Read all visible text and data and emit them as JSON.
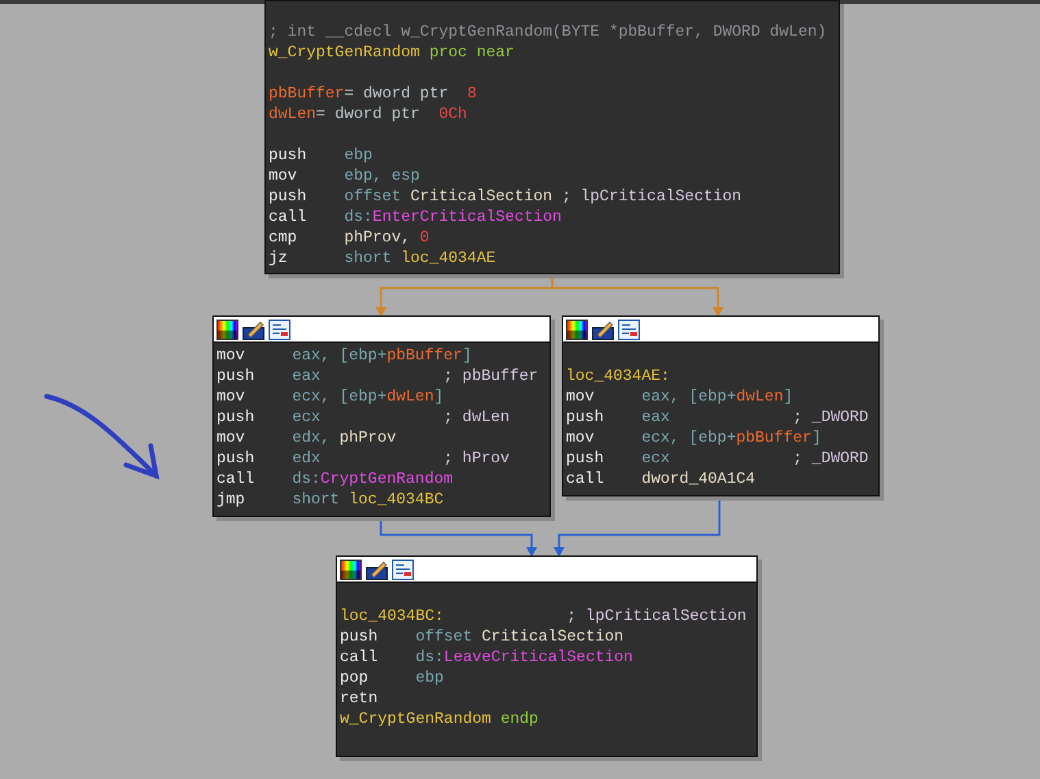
{
  "nodes": [
    {
      "toolbar": false,
      "lines": [
        {
          "kind": "code",
          "tokens": [
            {
              "kind": "header",
              "text": "; int __cdecl w_CryptGenRandom(BYTE *pbBuffer, DWORD dwLen)"
            }
          ]
        },
        {
          "kind": "code",
          "tokens": [
            {
              "kind": "label",
              "text": "w_CryptGenRandom"
            },
            {
              "kind": "keyword",
              "text": "proc near"
            }
          ]
        },
        {
          "kind": "blank"
        },
        {
          "kind": "code",
          "tokens": [
            {
              "kind": "var",
              "text": "pbBuffer"
            },
            {
              "kind": "plain",
              "text": "= dword ptr"
            },
            {
              "kind": "num",
              "text": " 8"
            }
          ]
        },
        {
          "kind": "code",
          "tokens": [
            {
              "kind": "var",
              "text": "dwLen"
            },
            {
              "kind": "plain",
              "text": "= dword ptr"
            },
            {
              "kind": "num",
              "text": " 0Ch"
            }
          ]
        },
        {
          "kind": "blank"
        },
        {
          "kind": "code",
          "tokens": [
            {
              "kind": "mnem",
              "text": "push"
            },
            {
              "kind": "reg",
              "text": "ebp"
            }
          ]
        },
        {
          "kind": "code",
          "tokens": [
            {
              "kind": "mnem",
              "text": "mov"
            },
            {
              "kind": "reg",
              "text": "ebp, esp"
            }
          ]
        },
        {
          "kind": "code",
          "tokens": [
            {
              "kind": "mnem",
              "text": "push"
            },
            {
              "kind": "reg",
              "text": "offset"
            },
            {
              "kind": "name",
              "text": "CriticalSection"
            }
          ],
          "comment": "; lpCriticalSection"
        },
        {
          "kind": "code",
          "tokens": [
            {
              "kind": "mnem",
              "text": "call"
            },
            {
              "kind": "reg",
              "text": "ds:"
            },
            {
              "kind": "import",
              "text": "EnterCriticalSection"
            }
          ]
        },
        {
          "kind": "code",
          "tokens": [
            {
              "kind": "mnem",
              "text": "cmp"
            },
            {
              "kind": "name",
              "text": "phProv,"
            },
            {
              "kind": "num",
              "text": "0"
            }
          ]
        },
        {
          "kind": "code",
          "tokens": [
            {
              "kind": "mnem",
              "text": "jz"
            },
            {
              "kind": "reg",
              "text": "short"
            },
            {
              "kind": "label",
              "text": "loc_4034AE"
            }
          ]
        }
      ]
    },
    {
      "toolbar": true,
      "lines": [
        {
          "kind": "code",
          "tokens": [
            {
              "kind": "mnem",
              "text": "mov"
            },
            {
              "kind": "reg",
              "text": "eax, [ebp+"
            },
            {
              "kind": "var",
              "text": "pbBuffer"
            },
            {
              "kind": "reg",
              "text": "]"
            }
          ]
        },
        {
          "kind": "code",
          "tokens": [
            {
              "kind": "mnem",
              "text": "push"
            },
            {
              "kind": "reg",
              "text": "eax"
            }
          ],
          "comment": "; pbBuffer"
        },
        {
          "kind": "code",
          "tokens": [
            {
              "kind": "mnem",
              "text": "mov"
            },
            {
              "kind": "reg",
              "text": "ecx, [ebp+"
            },
            {
              "kind": "var",
              "text": "dwLen"
            },
            {
              "kind": "reg",
              "text": "]"
            }
          ]
        },
        {
          "kind": "code",
          "tokens": [
            {
              "kind": "mnem",
              "text": "push"
            },
            {
              "kind": "reg",
              "text": "ecx"
            }
          ],
          "comment": "; dwLen"
        },
        {
          "kind": "code",
          "tokens": [
            {
              "kind": "mnem",
              "text": "mov"
            },
            {
              "kind": "reg",
              "text": "edx,"
            },
            {
              "kind": "name",
              "text": "phProv"
            }
          ]
        },
        {
          "kind": "code",
          "tokens": [
            {
              "kind": "mnem",
              "text": "push"
            },
            {
              "kind": "reg",
              "text": "edx"
            }
          ],
          "comment": "; hProv"
        },
        {
          "kind": "code",
          "tokens": [
            {
              "kind": "mnem",
              "text": "call"
            },
            {
              "kind": "reg",
              "text": "ds:"
            },
            {
              "kind": "import",
              "text": "CryptGenRandom"
            }
          ]
        },
        {
          "kind": "code",
          "tokens": [
            {
              "kind": "mnem",
              "text": "jmp"
            },
            {
              "kind": "reg",
              "text": "short"
            },
            {
              "kind": "label",
              "text": "loc_4034BC"
            }
          ]
        }
      ]
    },
    {
      "toolbar": true,
      "lines": [
        {
          "kind": "blank"
        },
        {
          "kind": "code",
          "tokens": [
            {
              "kind": "label",
              "text": "loc_4034AE:"
            }
          ]
        },
        {
          "kind": "code",
          "tokens": [
            {
              "kind": "mnem",
              "text": "mov"
            },
            {
              "kind": "reg",
              "text": "eax, [ebp+"
            },
            {
              "kind": "var",
              "text": "dwLen"
            },
            {
              "kind": "reg",
              "text": "]"
            }
          ]
        },
        {
          "kind": "code",
          "tokens": [
            {
              "kind": "mnem",
              "text": "push"
            },
            {
              "kind": "reg",
              "text": "eax"
            }
          ],
          "comment": "; _DWORD"
        },
        {
          "kind": "code",
          "tokens": [
            {
              "kind": "mnem",
              "text": "mov"
            },
            {
              "kind": "reg",
              "text": "ecx, [ebp+"
            },
            {
              "kind": "var",
              "text": "pbBuffer"
            },
            {
              "kind": "reg",
              "text": "]"
            }
          ]
        },
        {
          "kind": "code",
          "tokens": [
            {
              "kind": "mnem",
              "text": "push"
            },
            {
              "kind": "reg",
              "text": "ecx"
            }
          ],
          "comment": "; _DWORD"
        },
        {
          "kind": "code",
          "tokens": [
            {
              "kind": "mnem",
              "text": "call"
            },
            {
              "kind": "name",
              "text": "dword_40A1C4"
            }
          ]
        }
      ]
    },
    {
      "toolbar": true,
      "lines": [
        {
          "kind": "blank"
        },
        {
          "kind": "code",
          "tokens": [
            {
              "kind": "label",
              "text": "loc_4034BC:"
            }
          ],
          "comment": "; lpCriticalSection"
        },
        {
          "kind": "code",
          "tokens": [
            {
              "kind": "mnem",
              "text": "push"
            },
            {
              "kind": "reg",
              "text": "offset"
            },
            {
              "kind": "name",
              "text": "CriticalSection"
            }
          ]
        },
        {
          "kind": "code",
          "tokens": [
            {
              "kind": "mnem",
              "text": "call"
            },
            {
              "kind": "reg",
              "text": "ds:"
            },
            {
              "kind": "import",
              "text": "LeaveCriticalSection"
            }
          ]
        },
        {
          "kind": "code",
          "tokens": [
            {
              "kind": "mnem",
              "text": "pop"
            },
            {
              "kind": "reg",
              "text": "ebp"
            }
          ]
        },
        {
          "kind": "code",
          "tokens": [
            {
              "kind": "mnem",
              "text": "retn"
            }
          ]
        },
        {
          "kind": "code",
          "tokens": [
            {
              "kind": "label",
              "text": "w_CryptGenRandom"
            },
            {
              "kind": "keyword",
              "text": "endp"
            }
          ]
        }
      ]
    }
  ]
}
